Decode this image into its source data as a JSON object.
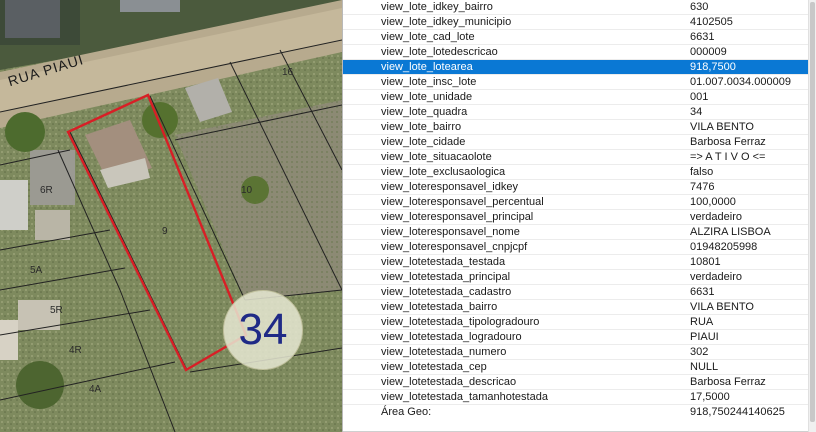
{
  "map": {
    "street_name": "RUA PIAUI",
    "lot_labels": [
      "16",
      "6R",
      "10",
      "9",
      "5A",
      "5R",
      "4R",
      "4A"
    ],
    "quadra_number": "34",
    "colors": {
      "highlight": "#d81f26",
      "lot_line": "#222222",
      "badge_text": "#1f2a86"
    }
  },
  "attributes": {
    "selected_index": 4,
    "rows": [
      {
        "key": "view_lote_idkey_bairro",
        "value": "630"
      },
      {
        "key": "view_lote_idkey_municipio",
        "value": "4102505"
      },
      {
        "key": "view_lote_cad_lote",
        "value": "6631"
      },
      {
        "key": "view_lote_lotedescricao",
        "value": "000009"
      },
      {
        "key": "view_lote_lotearea",
        "value": "918,7500"
      },
      {
        "key": "view_lote_insc_lote",
        "value": "01.007.0034.000009"
      },
      {
        "key": "view_lote_unidade",
        "value": "001"
      },
      {
        "key": "view_lote_quadra",
        "value": "34"
      },
      {
        "key": "view_lote_bairro",
        "value": "VILA BENTO"
      },
      {
        "key": "view_lote_cidade",
        "value": "Barbosa Ferraz"
      },
      {
        "key": "view_lote_situacaolote",
        "value": "=> A T I V O <="
      },
      {
        "key": "view_lote_exclusaologica",
        "value": "falso"
      },
      {
        "key": "view_loteresponsavel_idkey",
        "value": "7476"
      },
      {
        "key": "view_loteresponsavel_percentual",
        "value": "100,0000"
      },
      {
        "key": "view_loteresponsavel_principal",
        "value": "verdadeiro"
      },
      {
        "key": "view_loteresponsavel_nome",
        "value": "ALZIRA LISBOA"
      },
      {
        "key": "view_loteresponsavel_cnpjcpf",
        "value": "01948205998"
      },
      {
        "key": "view_lotetestada_testada",
        "value": "10801"
      },
      {
        "key": "view_lotetestada_principal",
        "value": "verdadeiro"
      },
      {
        "key": "view_lotetestada_cadastro",
        "value": "6631"
      },
      {
        "key": "view_lotetestada_bairro",
        "value": "VILA BENTO"
      },
      {
        "key": "view_lotetestada_tipologradouro",
        "value": "RUA"
      },
      {
        "key": "view_lotetestada_logradouro",
        "value": "PIAUI"
      },
      {
        "key": "view_lotetestada_numero",
        "value": "302"
      },
      {
        "key": "view_lotetestada_cep",
        "value": "NULL"
      },
      {
        "key": "view_lotetestada_descricao",
        "value": "Barbosa Ferraz"
      },
      {
        "key": "view_lotetestada_tamanhotestada",
        "value": "17,5000"
      },
      {
        "key": "Área Geo:",
        "value": "918,750244140625"
      }
    ]
  }
}
